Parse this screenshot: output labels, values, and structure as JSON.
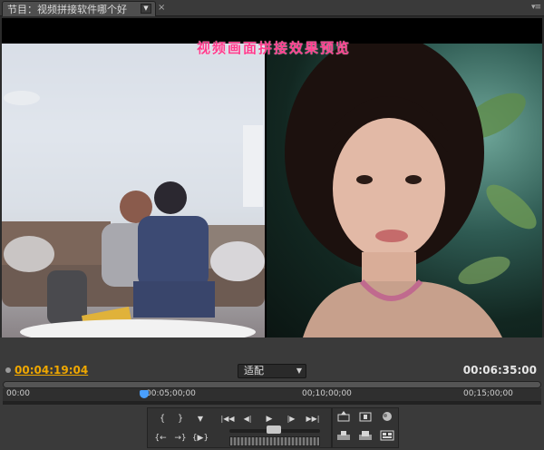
{
  "tab": {
    "label": "节目：视频拼接软件哪个好",
    "dropdown_icon": "chevron-down-icon",
    "close": "×",
    "menu_icon": "panel-menu-icon"
  },
  "viewer": {
    "overlay_title": "视频画面拼接效果预览"
  },
  "timecode": {
    "current": "00:04:19:04",
    "duration": "00:06:35:00"
  },
  "zoom": {
    "selected": "适配"
  },
  "ruler": {
    "labels": [
      "00:00",
      "00:05;00;00",
      "00;10;00;00",
      "00;15;00;00"
    ]
  },
  "colors": {
    "current_time": "#f0a800",
    "overlay_title": "#ff3d8e",
    "playhead": "#4aa0ff"
  },
  "transport": {
    "row1": [
      "{",
      "}",
      "▼",
      "|◀◀",
      "◀|",
      "▶",
      "|▶",
      "▶▶|"
    ],
    "row2": [
      "{←",
      "→}",
      "{▶}"
    ],
    "right_row1": [
      "lift-icon",
      "extract-icon",
      "output-icon"
    ],
    "right_row2": [
      "insert-icon",
      "overlay-icon",
      "export-frame-icon"
    ]
  }
}
